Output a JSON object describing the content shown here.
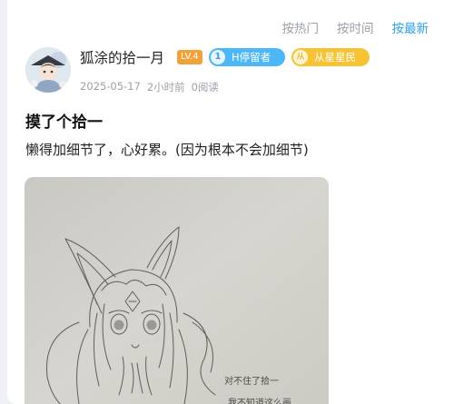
{
  "sort": {
    "hot": "按热门",
    "time": "按时间",
    "newest": "按最新"
  },
  "author": {
    "name": "狐涂的拾一月",
    "level": "LV.4",
    "badge_h_number": "1",
    "badge_h": "H停留者",
    "badge_star_icon": "从",
    "badge_star": "从星星民"
  },
  "meta": {
    "date": "2025-05-17",
    "relative_time": "2小时前",
    "reads": "0阅读"
  },
  "post": {
    "title": "摸了个拾一",
    "body": "懒得加细节了，心好累。(因为根本不会加细节)",
    "sketch_caption_1": "对不住了拾一",
    "sketch_caption_2": "我不知道这么画"
  },
  "colors": {
    "accent": "#2ea0ea",
    "level_badge": "#f2a23a",
    "h_badge": "#4db7f5",
    "star_badge": "#f5c333"
  }
}
